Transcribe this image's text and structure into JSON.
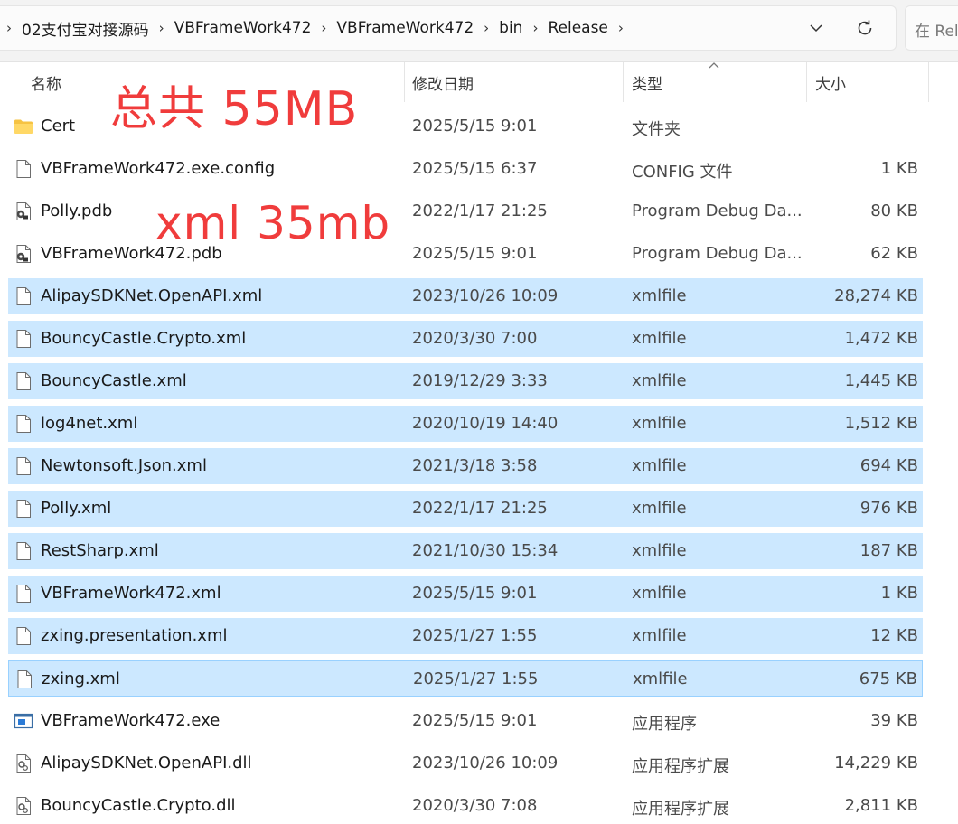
{
  "breadcrumbs": [
    "02支付宝对接源码",
    "VBFrameWork472",
    "VBFrameWork472",
    "bin",
    "Release"
  ],
  "search": {
    "placeholder": "在 Rel"
  },
  "columns": {
    "name": "名称",
    "date": "修改日期",
    "type": "类型",
    "size": "大小"
  },
  "annotations": {
    "total": "总共   55MB",
    "xml": "xml 35mb"
  },
  "files": [
    {
      "name": "Cert",
      "date": "2025/5/15 9:01",
      "type": "文件夹",
      "size": "",
      "icon": "folder-icon",
      "selected": false
    },
    {
      "name": "VBFrameWork472.exe.config",
      "date": "2025/5/15 6:37",
      "type": "CONFIG 文件",
      "size": "1 KB",
      "icon": "file-icon",
      "selected": false
    },
    {
      "name": "Polly.pdb",
      "date": "2022/1/17 21:25",
      "type": "Program Debug Da...",
      "size": "80 KB",
      "icon": "pdb-file-icon",
      "selected": false
    },
    {
      "name": "VBFrameWork472.pdb",
      "date": "2025/5/15 9:01",
      "type": "Program Debug Da...",
      "size": "62 KB",
      "icon": "pdb-file-icon",
      "selected": false
    },
    {
      "name": "AlipaySDKNet.OpenAPI.xml",
      "date": "2023/10/26 10:09",
      "type": "xmlfile",
      "size": "28,274 KB",
      "icon": "file-icon",
      "selected": true
    },
    {
      "name": "BouncyCastle.Crypto.xml",
      "date": "2020/3/30 7:00",
      "type": "xmlfile",
      "size": "1,472 KB",
      "icon": "file-icon",
      "selected": true
    },
    {
      "name": "BouncyCastle.xml",
      "date": "2019/12/29 3:33",
      "type": "xmlfile",
      "size": "1,445 KB",
      "icon": "file-icon",
      "selected": true
    },
    {
      "name": "log4net.xml",
      "date": "2020/10/19 14:40",
      "type": "xmlfile",
      "size": "1,512 KB",
      "icon": "file-icon",
      "selected": true
    },
    {
      "name": "Newtonsoft.Json.xml",
      "date": "2021/3/18 3:58",
      "type": "xmlfile",
      "size": "694 KB",
      "icon": "file-icon",
      "selected": true
    },
    {
      "name": "Polly.xml",
      "date": "2022/1/17 21:25",
      "type": "xmlfile",
      "size": "976 KB",
      "icon": "file-icon",
      "selected": true
    },
    {
      "name": "RestSharp.xml",
      "date": "2021/10/30 15:34",
      "type": "xmlfile",
      "size": "187 KB",
      "icon": "file-icon",
      "selected": true
    },
    {
      "name": "VBFrameWork472.xml",
      "date": "2025/5/15 9:01",
      "type": "xmlfile",
      "size": "1 KB",
      "icon": "file-icon",
      "selected": true
    },
    {
      "name": "zxing.presentation.xml",
      "date": "2025/1/27 1:55",
      "type": "xmlfile",
      "size": "12 KB",
      "icon": "file-icon",
      "selected": true
    },
    {
      "name": "zxing.xml",
      "date": "2025/1/27 1:55",
      "type": "xmlfile",
      "size": "675 KB",
      "icon": "file-icon",
      "selected": true
    },
    {
      "name": "VBFrameWork472.exe",
      "date": "2025/5/15 9:01",
      "type": "应用程序",
      "size": "39 KB",
      "icon": "exe-icon",
      "selected": false
    },
    {
      "name": "AlipaySDKNet.OpenAPI.dll",
      "date": "2023/10/26 10:09",
      "type": "应用程序扩展",
      "size": "14,229 KB",
      "icon": "dll-icon",
      "selected": false
    },
    {
      "name": "BouncyCastle.Crypto.dll",
      "date": "2020/3/30 7:08",
      "type": "应用程序扩展",
      "size": "2,811 KB",
      "icon": "dll-icon",
      "selected": false
    }
  ]
}
